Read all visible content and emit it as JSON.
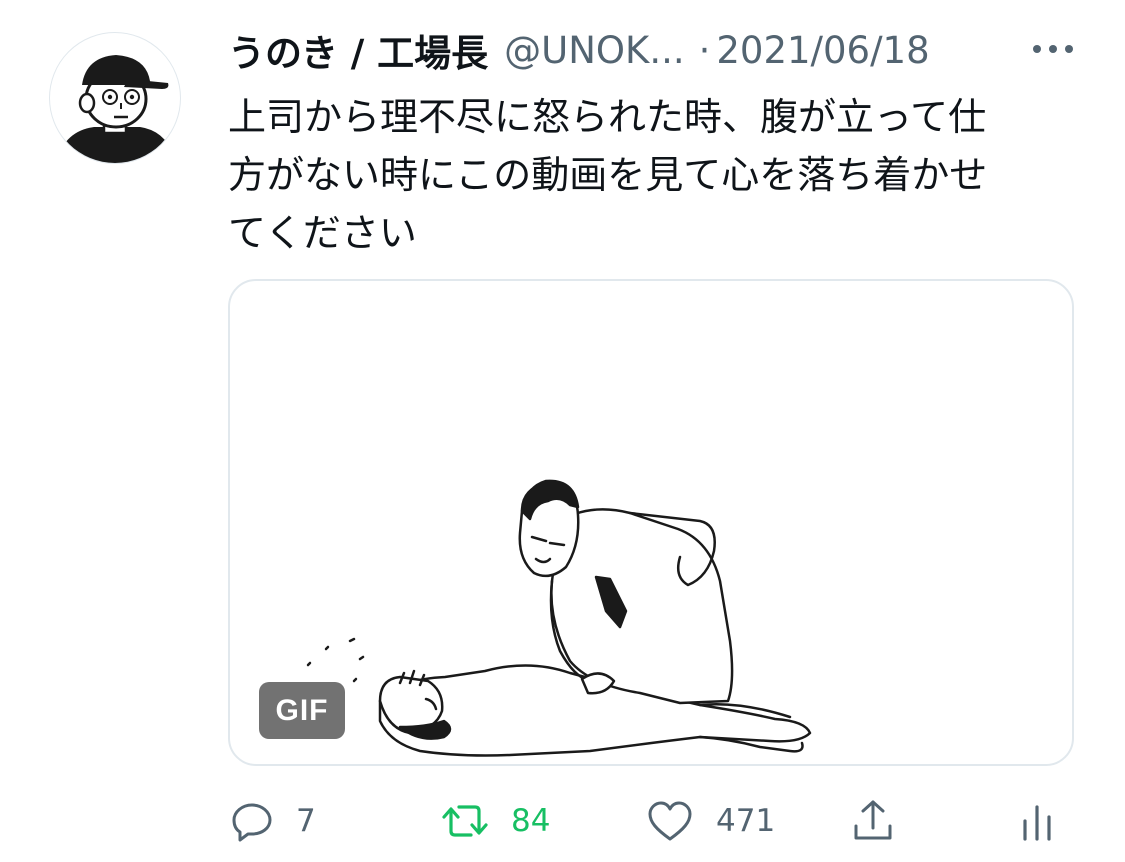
{
  "tweet": {
    "display_name": "うのき / 工場長",
    "handle": "@UNOK...",
    "separator": "·",
    "date": "2021/06/18",
    "text_lines": [
      "上司から理不尽に怒られた時、腹が立って仕",
      "方がない時にこの動画を見て心を落ち着かせ",
      "てください"
    ],
    "media": {
      "type": "gif",
      "badge_label": "GIF"
    },
    "actions": {
      "reply_count": "7",
      "retweet_count": "84",
      "like_count": "471"
    },
    "icons": {
      "more": "more-horizontal-icon",
      "reply": "reply-icon",
      "retweet": "retweet-icon",
      "like": "heart-icon",
      "share": "share-icon",
      "analytics": "analytics-icon"
    },
    "colors": {
      "text_primary": "#0f1419",
      "text_secondary": "#536471",
      "retweet_green": "#17bf63",
      "border": "#e1e8ed"
    }
  }
}
